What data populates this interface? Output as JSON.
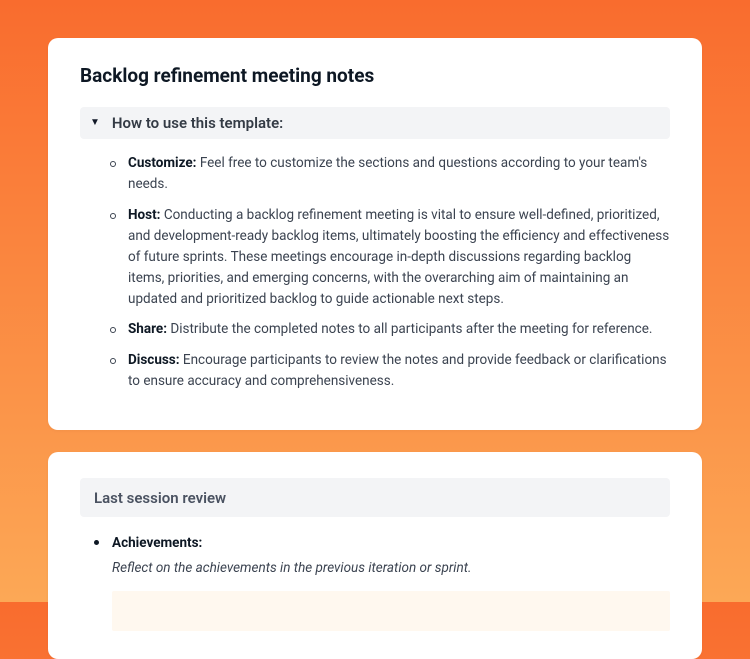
{
  "title": "Backlog refinement meeting notes",
  "howTo": {
    "heading": "How to use this template:",
    "items": [
      {
        "label": "Customize:",
        "text": " Feel free to customize the sections and questions according to your team's needs."
      },
      {
        "label": "Host:",
        "text": " Conducting a backlog refinement meeting is vital to ensure well-defined, prioritized, and development-ready backlog items, ultimately boosting the efficiency and effectiveness of future sprints. These meetings encourage in-depth discussions regarding backlog items, priorities, and emerging concerns, with the overarching aim of maintaining an updated and prioritized backlog to guide actionable next steps."
      },
      {
        "label": "Share:",
        "text": " Distribute the completed notes to all participants after the meeting for reference."
      },
      {
        "label": "Discuss:",
        "text": " Encourage participants to review the notes and provide feedback or clarifications to ensure accuracy and comprehensiveness."
      }
    ]
  },
  "lastSession": {
    "heading": "Last session review",
    "achievementsLabel": "Achievements:",
    "achievementsPrompt": "Reflect on the achievements in the previous iteration or sprint."
  }
}
